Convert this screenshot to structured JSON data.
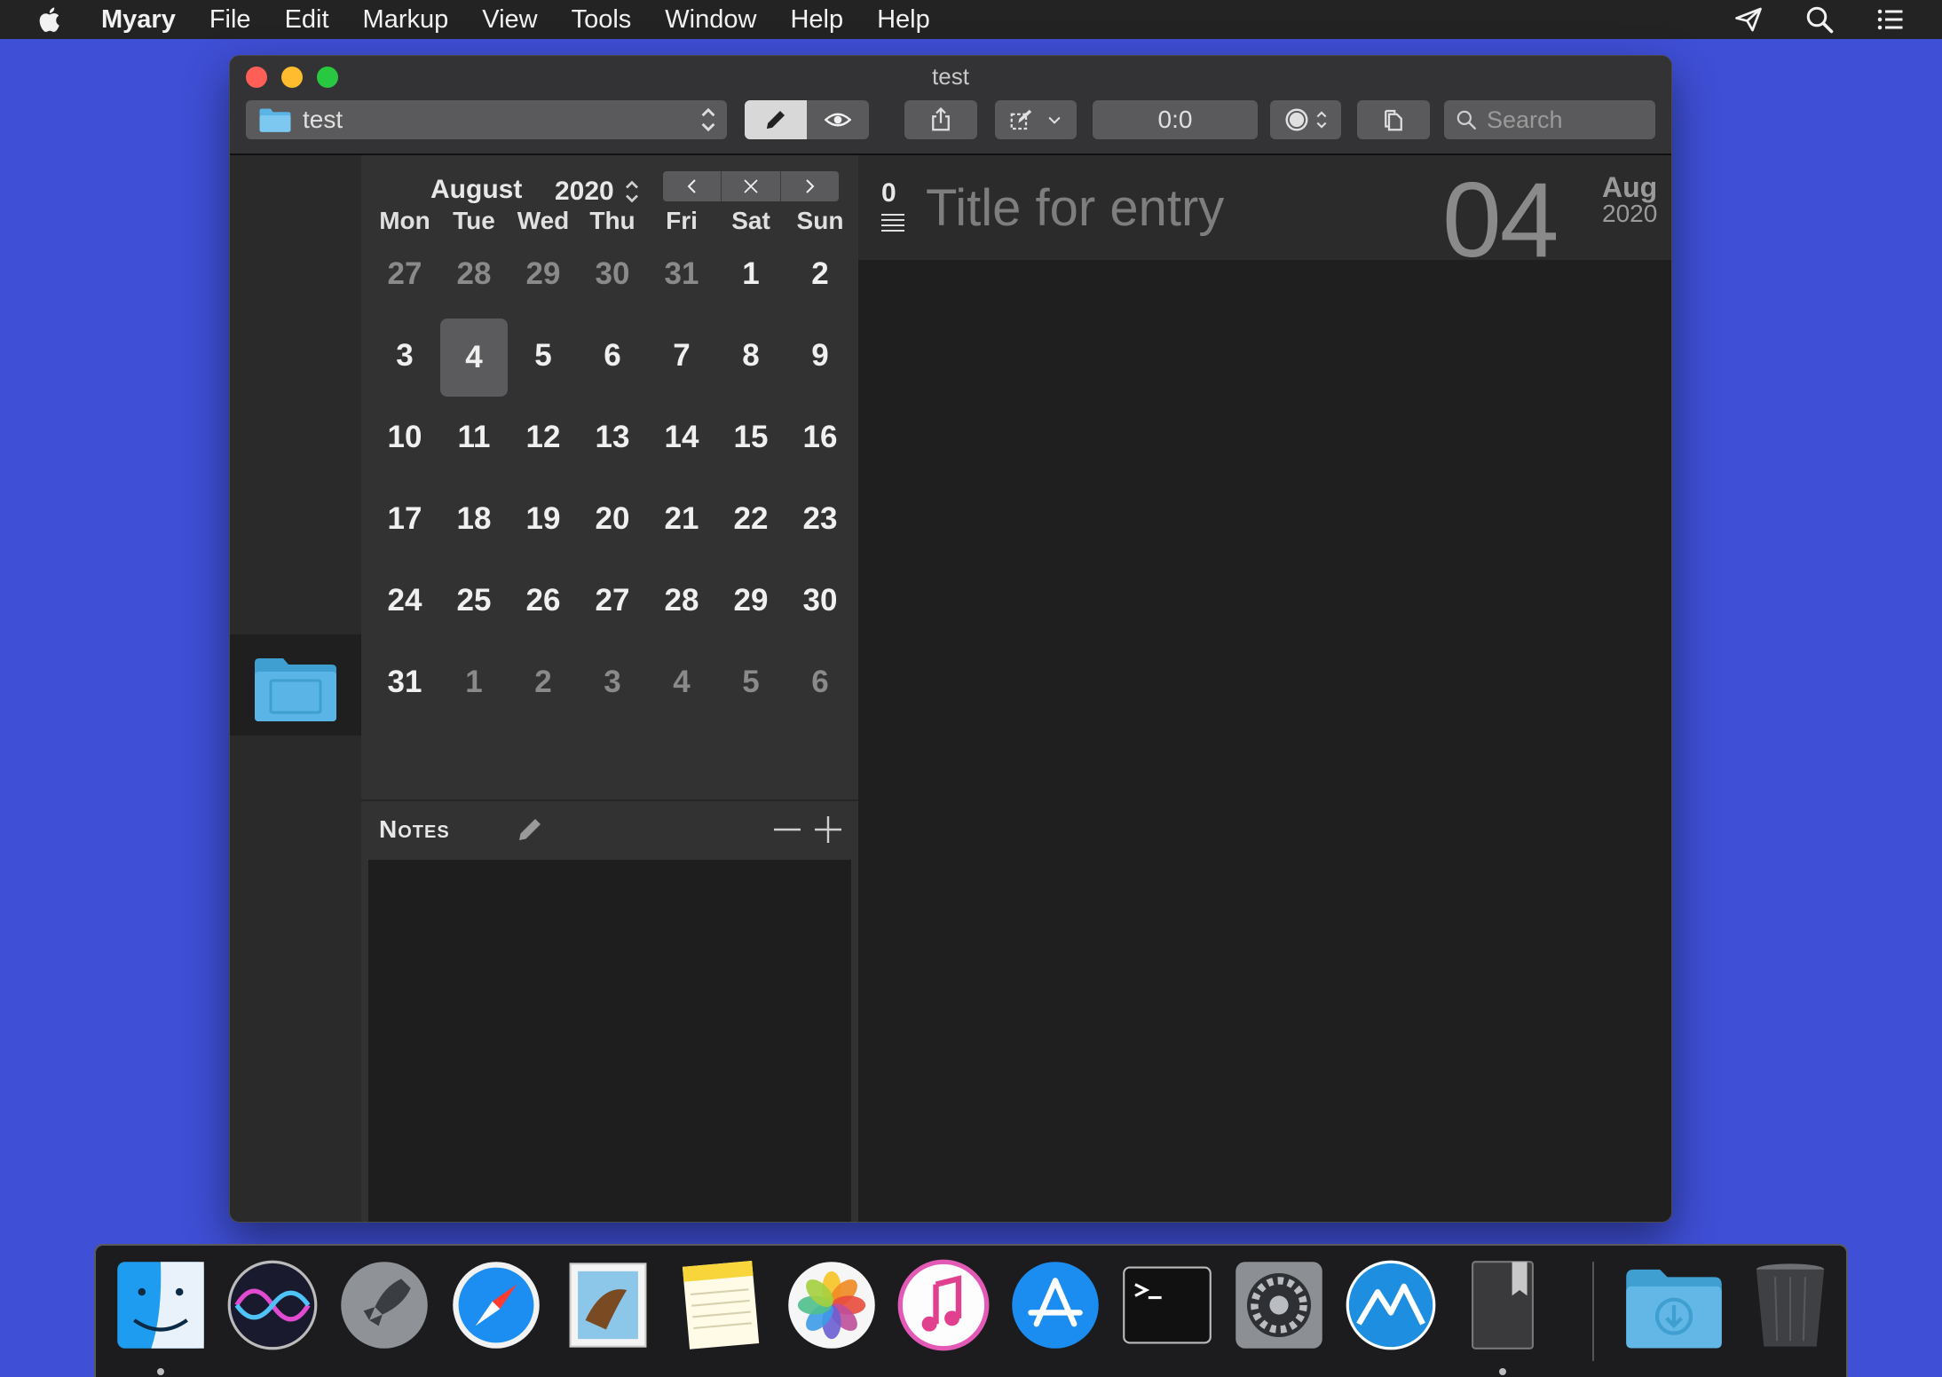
{
  "menubar": {
    "app": "Myary",
    "items": [
      "File",
      "Edit",
      "Markup",
      "View",
      "Tools",
      "Window",
      "Help",
      "Help"
    ]
  },
  "window": {
    "title": "test",
    "folder": "test",
    "timer": "0:0",
    "search_placeholder": "Search"
  },
  "calendar": {
    "month": "August",
    "year": "2020",
    "weekdays": [
      "Mon",
      "Tue",
      "Wed",
      "Thu",
      "Fri",
      "Sat",
      "Sun"
    ],
    "days": [
      [
        "27",
        true
      ],
      [
        "28",
        true
      ],
      [
        "29",
        true
      ],
      [
        "30",
        true
      ],
      [
        "31",
        true
      ],
      [
        "1",
        false
      ],
      [
        "2",
        false
      ],
      [
        "3",
        false
      ],
      [
        "4",
        false
      ],
      [
        "5",
        false
      ],
      [
        "6",
        false
      ],
      [
        "7",
        false
      ],
      [
        "8",
        false
      ],
      [
        "9",
        false
      ],
      [
        "10",
        false
      ],
      [
        "11",
        false
      ],
      [
        "12",
        false
      ],
      [
        "13",
        false
      ],
      [
        "14",
        false
      ],
      [
        "15",
        false
      ],
      [
        "16",
        false
      ],
      [
        "17",
        false
      ],
      [
        "18",
        false
      ],
      [
        "19",
        false
      ],
      [
        "20",
        false
      ],
      [
        "21",
        false
      ],
      [
        "22",
        false
      ],
      [
        "23",
        false
      ],
      [
        "24",
        false
      ],
      [
        "25",
        false
      ],
      [
        "26",
        false
      ],
      [
        "27",
        false
      ],
      [
        "28",
        false
      ],
      [
        "29",
        false
      ],
      [
        "30",
        false
      ],
      [
        "31",
        false
      ],
      [
        "1",
        true
      ],
      [
        "2",
        true
      ],
      [
        "3",
        true
      ],
      [
        "4",
        true
      ],
      [
        "5",
        true
      ],
      [
        "6",
        true
      ]
    ],
    "selected_index": 8
  },
  "notes": {
    "title": "Notes"
  },
  "entry": {
    "count": "0",
    "title_placeholder": "Title for entry",
    "day": "04",
    "month": "Aug",
    "year": "2020"
  },
  "colors": {
    "desktop": "#3f4fd6",
    "window_bg": "#1e1e1e",
    "panel": "#323233",
    "accent_folder": "#5ab4e5"
  },
  "dock": {
    "apps": [
      "finder-icon",
      "siri-icon",
      "launchpad-icon",
      "safari-icon",
      "mail-icon",
      "notes-icon",
      "photos-icon",
      "music-icon",
      "app-store-icon",
      "terminal-icon",
      "system-preferences-icon",
      "myary-icon",
      "journal-icon",
      "downloads-folder-icon",
      "trash-icon"
    ]
  }
}
